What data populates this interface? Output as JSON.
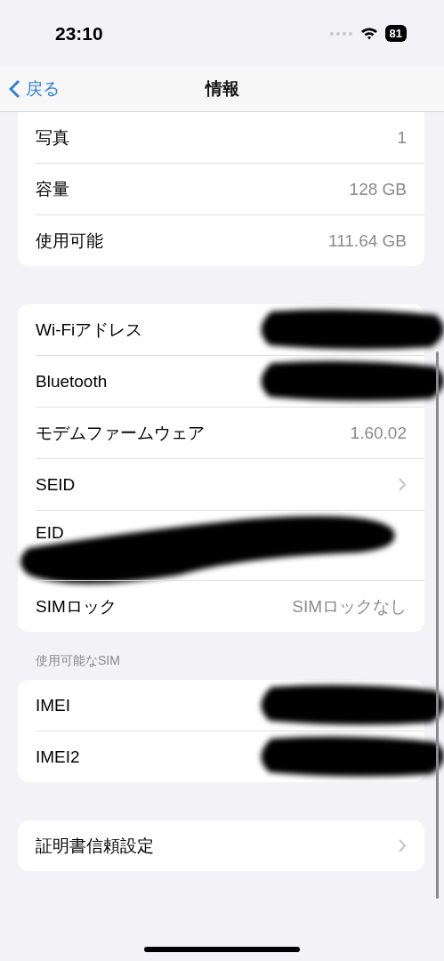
{
  "status_bar": {
    "time": "23:10",
    "battery": "81"
  },
  "nav": {
    "back": "戻る",
    "title": "情報"
  },
  "sections": [
    {
      "rows": [
        {
          "kind": "value",
          "label": "写真",
          "value": "1"
        },
        {
          "kind": "value",
          "label": "容量",
          "value": "128 GB"
        },
        {
          "kind": "value",
          "label": "使用可能",
          "value": "111.64 GB"
        }
      ]
    },
    {
      "rows": [
        {
          "kind": "redacted",
          "label": "Wi-Fiアドレス"
        },
        {
          "kind": "redacted",
          "label": "Bluetooth"
        },
        {
          "kind": "value",
          "label": "モデムファームウェア",
          "value": "1.60.02"
        },
        {
          "kind": "chevron",
          "label": "SEID"
        },
        {
          "kind": "redacted-tall",
          "label": "EID"
        },
        {
          "kind": "value",
          "label": "SIMロック",
          "value": "SIMロックなし"
        }
      ]
    },
    {
      "header": "使用可能なSIM",
      "rows": [
        {
          "kind": "redacted",
          "label": "IMEI"
        },
        {
          "kind": "redacted",
          "label": "IMEI2"
        }
      ]
    },
    {
      "rows": [
        {
          "kind": "chevron",
          "label": "証明書信頼設定"
        }
      ]
    }
  ]
}
